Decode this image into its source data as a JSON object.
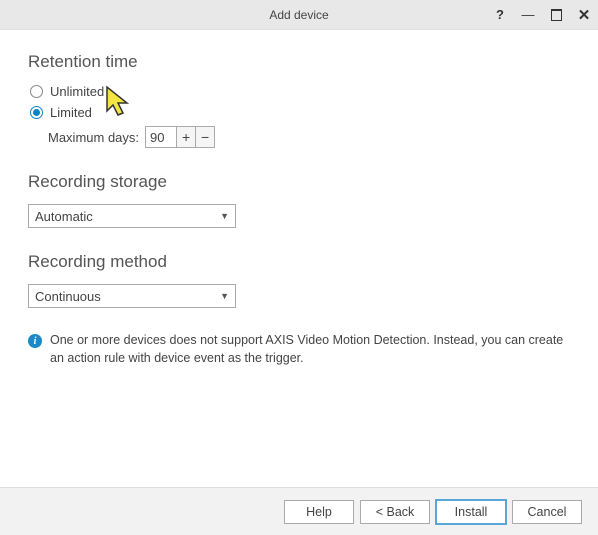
{
  "titlebar": {
    "title": "Add device",
    "help": "?",
    "minimize": "—",
    "close": "✕"
  },
  "retention": {
    "heading": "Retention time",
    "unlimited_label": "Unlimited",
    "limited_label": "Limited",
    "maxdays_label": "Maximum days:",
    "maxdays_value": "90",
    "plus": "+",
    "minus": "−"
  },
  "storage": {
    "heading": "Recording storage",
    "selected": "Automatic"
  },
  "method": {
    "heading": "Recording method",
    "selected": "Continuous"
  },
  "info": {
    "icon": "i",
    "text": "One or more devices does not support AXIS Video Motion Detection. Instead, you can create an action rule with device event as the trigger."
  },
  "footer": {
    "help": "Help",
    "back": "<  Back",
    "install": "Install",
    "cancel": "Cancel"
  }
}
